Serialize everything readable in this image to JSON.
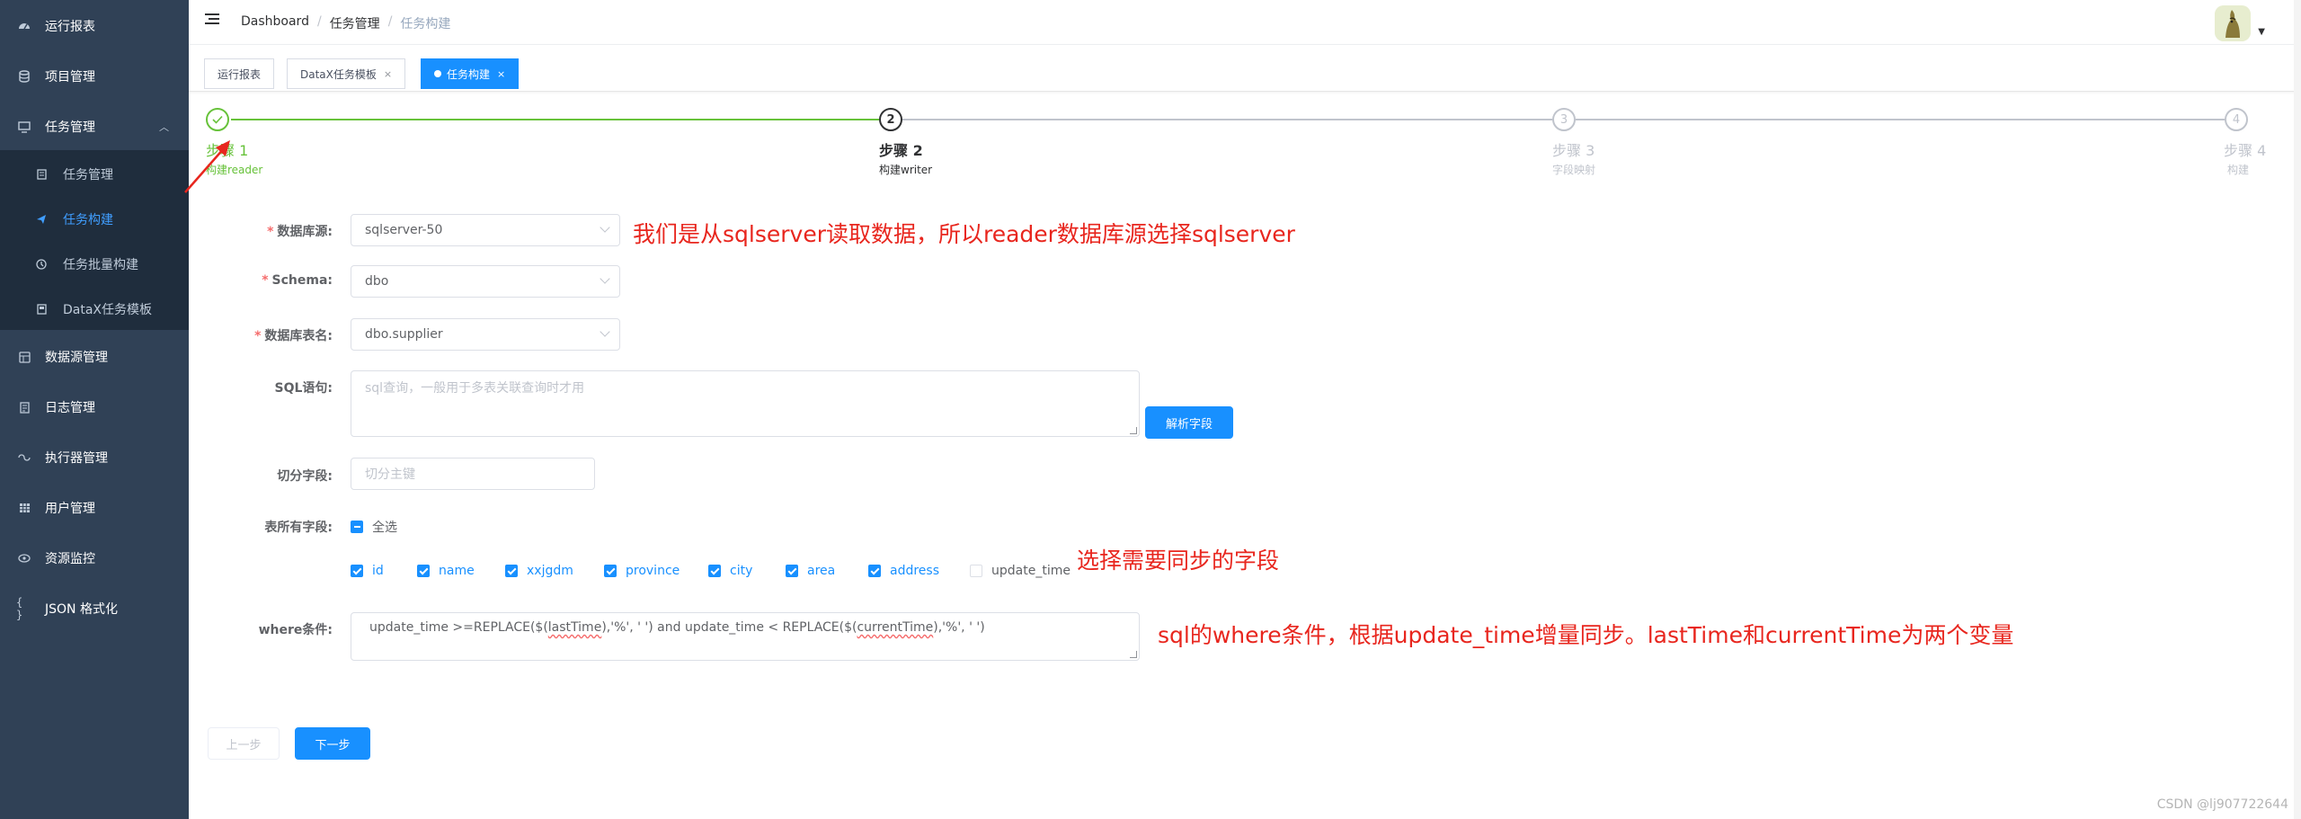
{
  "sidebar": {
    "items": [
      {
        "label": "运行报表",
        "icon": "dashboard-icon"
      },
      {
        "label": "项目管理",
        "icon": "database-icon"
      },
      {
        "label": "任务管理",
        "icon": "monitor-icon"
      },
      {
        "label": "数据源管理",
        "icon": "datasource-icon"
      },
      {
        "label": "日志管理",
        "icon": "log-icon"
      },
      {
        "label": "执行器管理",
        "icon": "executor-icon"
      },
      {
        "label": "用户管理",
        "icon": "table-icon"
      },
      {
        "label": "资源监控",
        "icon": "monitor-eye-icon"
      },
      {
        "label": "JSON 格式化",
        "icon": "json-icon"
      }
    ],
    "sub_items": [
      {
        "label": "任务管理",
        "icon": "task-icon"
      },
      {
        "label": "任务构建",
        "icon": "send-icon"
      },
      {
        "label": "任务批量构建",
        "icon": "batch-icon"
      },
      {
        "label": "DataX任务模板",
        "icon": "template-icon"
      }
    ]
  },
  "header": {
    "breadcrumb": [
      "Dashboard",
      "任务管理",
      "任务构建"
    ],
    "breadcrumb_sep": "/"
  },
  "tags": {
    "items": [
      "运行报表",
      "DataX任务模板",
      "任务构建"
    ],
    "close": "×"
  },
  "steps": [
    {
      "title": "步骤 1",
      "desc": "构建reader",
      "num": "✓",
      "status": "success"
    },
    {
      "title": "步骤 2",
      "desc": "构建writer",
      "num": "2",
      "status": "process"
    },
    {
      "title": "步骤 3",
      "desc": "字段映射",
      "num": "3",
      "status": "wait"
    },
    {
      "title": "步骤 4",
      "desc": "构建",
      "num": "4",
      "status": "wait"
    }
  ],
  "form": {
    "datasource_label": "数据库源:",
    "datasource_value": "sqlserver-50",
    "schema_label": "Schema:",
    "schema_value": "dbo",
    "table_label": "数据库表名:",
    "table_value": "dbo.supplier",
    "sql_label": "SQL语句:",
    "sql_placeholder": "sql查询，一般用于多表关联查询时才用",
    "parse_button": "解析字段",
    "split_label": "切分字段:",
    "split_placeholder": "切分主键",
    "fields_label": "表所有字段:",
    "select_all": "全选",
    "fields": [
      {
        "name": "id",
        "checked": true
      },
      {
        "name": "name",
        "checked": true
      },
      {
        "name": "xxjgdm",
        "checked": true
      },
      {
        "name": "province",
        "checked": true
      },
      {
        "name": "city",
        "checked": true
      },
      {
        "name": "area",
        "checked": true
      },
      {
        "name": "address",
        "checked": true
      },
      {
        "name": "update_time",
        "checked": false
      }
    ],
    "where_label": "where条件:",
    "where_parts": [
      "update_time >=REPLACE($(",
      "lastTime",
      "),'%', ' ') and update_time < REPLACE($(",
      "currentTime",
      "),'%', ' ')"
    ],
    "prev_button": "上一步",
    "next_button": "下一步"
  },
  "annotations": {
    "datasource_note": "我们是从sqlserver读取数据，所以reader数据库源选择sqlserver",
    "fields_note": "选择需要同步的字段",
    "where_note": "sql的where条件，根据update_time增量同步。lastTime和currentTime为两个变量",
    "color": "#e8261e"
  },
  "watermark": "CSDN @lj907722644",
  "colors": {
    "sidebar_bg": "#304156",
    "submenu_bg": "#1f2d3d",
    "primary": "#1890ff",
    "success": "#67c23a",
    "required": "#f56c6c"
  }
}
